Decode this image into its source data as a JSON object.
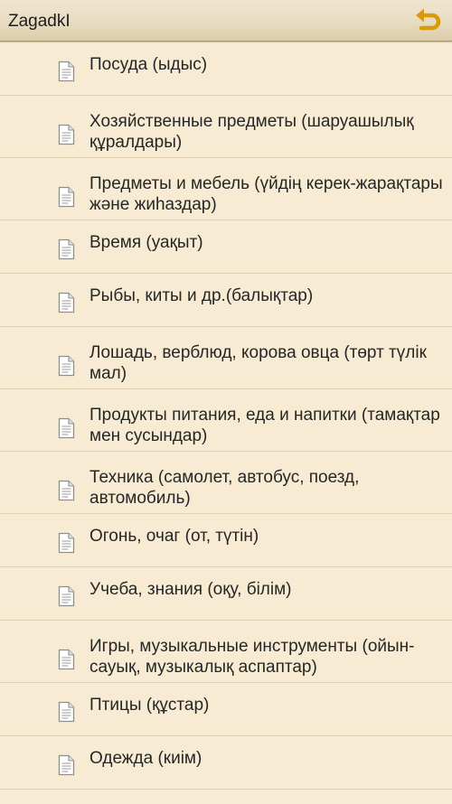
{
  "app": {
    "title": "ZagadkI",
    "back_icon": "undo-arrow-icon"
  },
  "colors": {
    "background": "#f7ecd3",
    "header": "#e8dcc1",
    "back_arrow": "#d9990f",
    "divider": "#e3d3b3"
  },
  "categories": [
    {
      "label": "Посуда (ыдыс)",
      "icon": "document-icon"
    },
    {
      "label": "Хозяйственные предметы (шаруашылық құралдары)",
      "icon": "document-icon"
    },
    {
      "label": "Предметы и мебель (үйдің керек-жарақтары және жиһаздар)",
      "icon": "document-icon"
    },
    {
      "label": "Время (уақыт)",
      "icon": "document-icon"
    },
    {
      "label": "Рыбы, киты и др.(балықтар)",
      "icon": "document-icon"
    },
    {
      "label": "Лошадь, верблюд, корова овца (төрт түлік мал)",
      "icon": "document-icon"
    },
    {
      "label": "Продукты питания, еда и напитки (тамақтар мен сусындар)",
      "icon": "document-icon"
    },
    {
      "label": "Техника (самолет, автобус, поезд, автомобиль)",
      "icon": "document-icon"
    },
    {
      "label": "Огонь, очаг (от, түтін)",
      "icon": "document-icon"
    },
    {
      "label": "Учеба, знания (оқу, білім)",
      "icon": "document-icon"
    },
    {
      "label": "Игры, музыкальные инструменты (ойын-сауық, музыкалық аспаптар)",
      "icon": "document-icon"
    },
    {
      "label": "Птицы (құстар)",
      "icon": "document-icon"
    },
    {
      "label": "Одежда (киім)",
      "icon": "document-icon"
    }
  ]
}
